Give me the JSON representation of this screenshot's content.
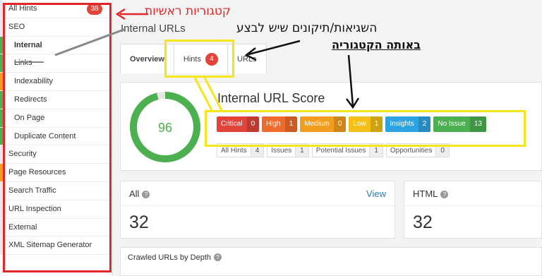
{
  "sidebar": {
    "items": [
      {
        "label": "All Hints",
        "badge": "38",
        "sub": false,
        "bar": "#e8e8e8"
      },
      {
        "label": "SEO",
        "sub": false,
        "bar": "#e8e8e8"
      },
      {
        "label": "Internal",
        "sub": true,
        "active": true,
        "bar": "#4caf50"
      },
      {
        "label": "Links",
        "sub": true,
        "bar": "#4caf50"
      },
      {
        "label": "Indexability",
        "sub": true,
        "bar": "#f29d1e"
      },
      {
        "label": "Redirects",
        "sub": true,
        "bar": "#4caf50"
      },
      {
        "label": "On Page",
        "sub": true,
        "bar": "#4caf50"
      },
      {
        "label": "Duplicate Content",
        "sub": true,
        "bar": "#4caf50"
      },
      {
        "label": "Security",
        "sub": false,
        "bar": "#e8e8e8"
      },
      {
        "label": "Page Resources",
        "sub": false,
        "bar": "#f29d1e"
      },
      {
        "label": "Search Traffic",
        "sub": false,
        "bar": "#e8e8e8"
      },
      {
        "label": "URL Inspection",
        "sub": false,
        "bar": "#e8e8e8"
      },
      {
        "label": "External",
        "sub": false,
        "bar": "#e8e8e8"
      },
      {
        "label": "XML Sitemap Generator",
        "sub": false,
        "bar": "#e8e8e8"
      }
    ]
  },
  "page": {
    "title": "Internal URLs"
  },
  "tabs": [
    {
      "label": "Overview"
    },
    {
      "label": "Hints",
      "badge": "4"
    },
    {
      "label": "URLs"
    }
  ],
  "score": {
    "title": "Internal URL Score",
    "value": "96",
    "fraction": 0.96
  },
  "pills": [
    {
      "label": "Critical",
      "count": "0",
      "color": "#e2443a"
    },
    {
      "label": "High",
      "count": "1",
      "color": "#f06a2b"
    },
    {
      "label": "Medium",
      "count": "0",
      "color": "#f29d1e"
    },
    {
      "label": "Low",
      "count": "1",
      "color": "#f4bf17"
    },
    {
      "label": "Insights",
      "count": "2",
      "color": "#2ea3e3"
    },
    {
      "label": "No Issue",
      "count": "13",
      "color": "#4caf50"
    }
  ],
  "filters": [
    {
      "label": "All Hints",
      "count": "4"
    },
    {
      "label": "Issues",
      "count": "1"
    },
    {
      "label": "Potential Issues",
      "count": "1"
    },
    {
      "label": "Opportunities",
      "count": "0"
    }
  ],
  "stats": {
    "all": {
      "label": "All",
      "link": "View",
      "value": "32"
    },
    "html": {
      "label": "HTML",
      "value": "32"
    }
  },
  "depth": {
    "title": "Crawled URLs by Depth"
  },
  "annotations": {
    "main_categories": "קטגוריות ראשיות",
    "errors_line1": "השגיאות/תיקונים שיש לבצע",
    "errors_line2": "באותה הקטגוריה"
  },
  "colors": {
    "annotation_red": "#e3262a",
    "annotation_yellow": "#f5e61c",
    "annotation_gray": "#888888"
  }
}
